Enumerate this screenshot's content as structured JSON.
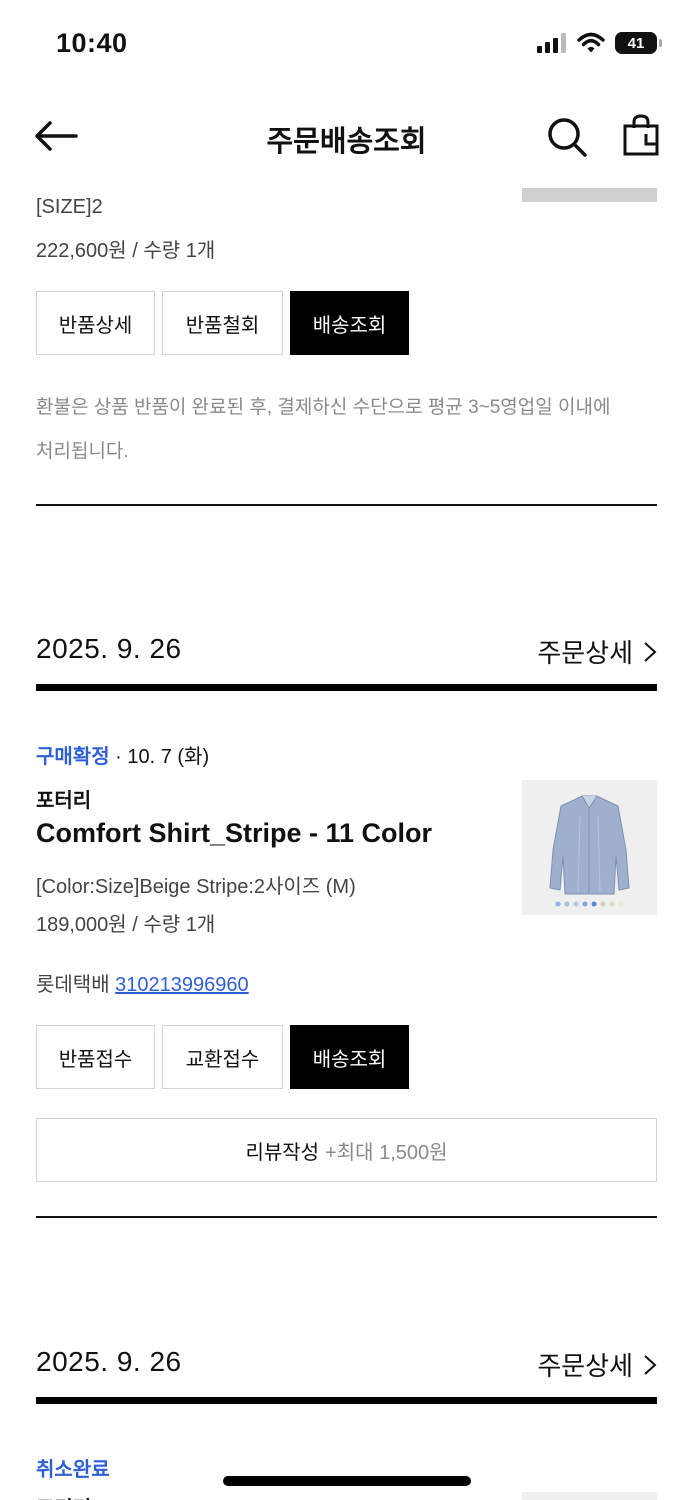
{
  "status_bar": {
    "time": "10:40",
    "battery": "41"
  },
  "header": {
    "title": "주문배송조회"
  },
  "order1": {
    "size_option": "[SIZE]2",
    "price_qty": "222,600원 / 수량 1개",
    "buttons": [
      "반품상세",
      "반품철회",
      "배송조회"
    ],
    "notice_line1": "환불은 상품 반품이 완료된 후, 결제하신 수단으로 평균 3~5영업일 이내에",
    "notice_line2": "처리됩니다."
  },
  "order2": {
    "date": "2025. 9. 26",
    "detail_link": "주문상세",
    "status": "구매확정",
    "status_date": "· 10. 7 (화)",
    "brand": "포터리",
    "product_name": "Comfort Shirt_Stripe - 11 Color",
    "option": "[Color:Size]Beige Stripe:2사이즈 (M)",
    "price_qty": "189,000원 / 수량 1개",
    "courier": "롯데택배",
    "tracking_number": "310213996960",
    "buttons": [
      "반품접수",
      "교환접수",
      "배송조회"
    ],
    "review_label": "리뷰작성",
    "review_bonus": "+최대 1,500원"
  },
  "order3": {
    "date": "2025. 9. 26",
    "detail_link": "주문상세",
    "status": "취소완료",
    "brand": "포터리"
  },
  "colors": {
    "accent_blue": "#2f5fd6",
    "dark_button": "#000000"
  },
  "icons": [
    "back-arrow-icon",
    "search-icon",
    "shopping-bag-icon",
    "chevron-right-icon",
    "signal-icon",
    "wifi-icon",
    "battery-icon"
  ]
}
